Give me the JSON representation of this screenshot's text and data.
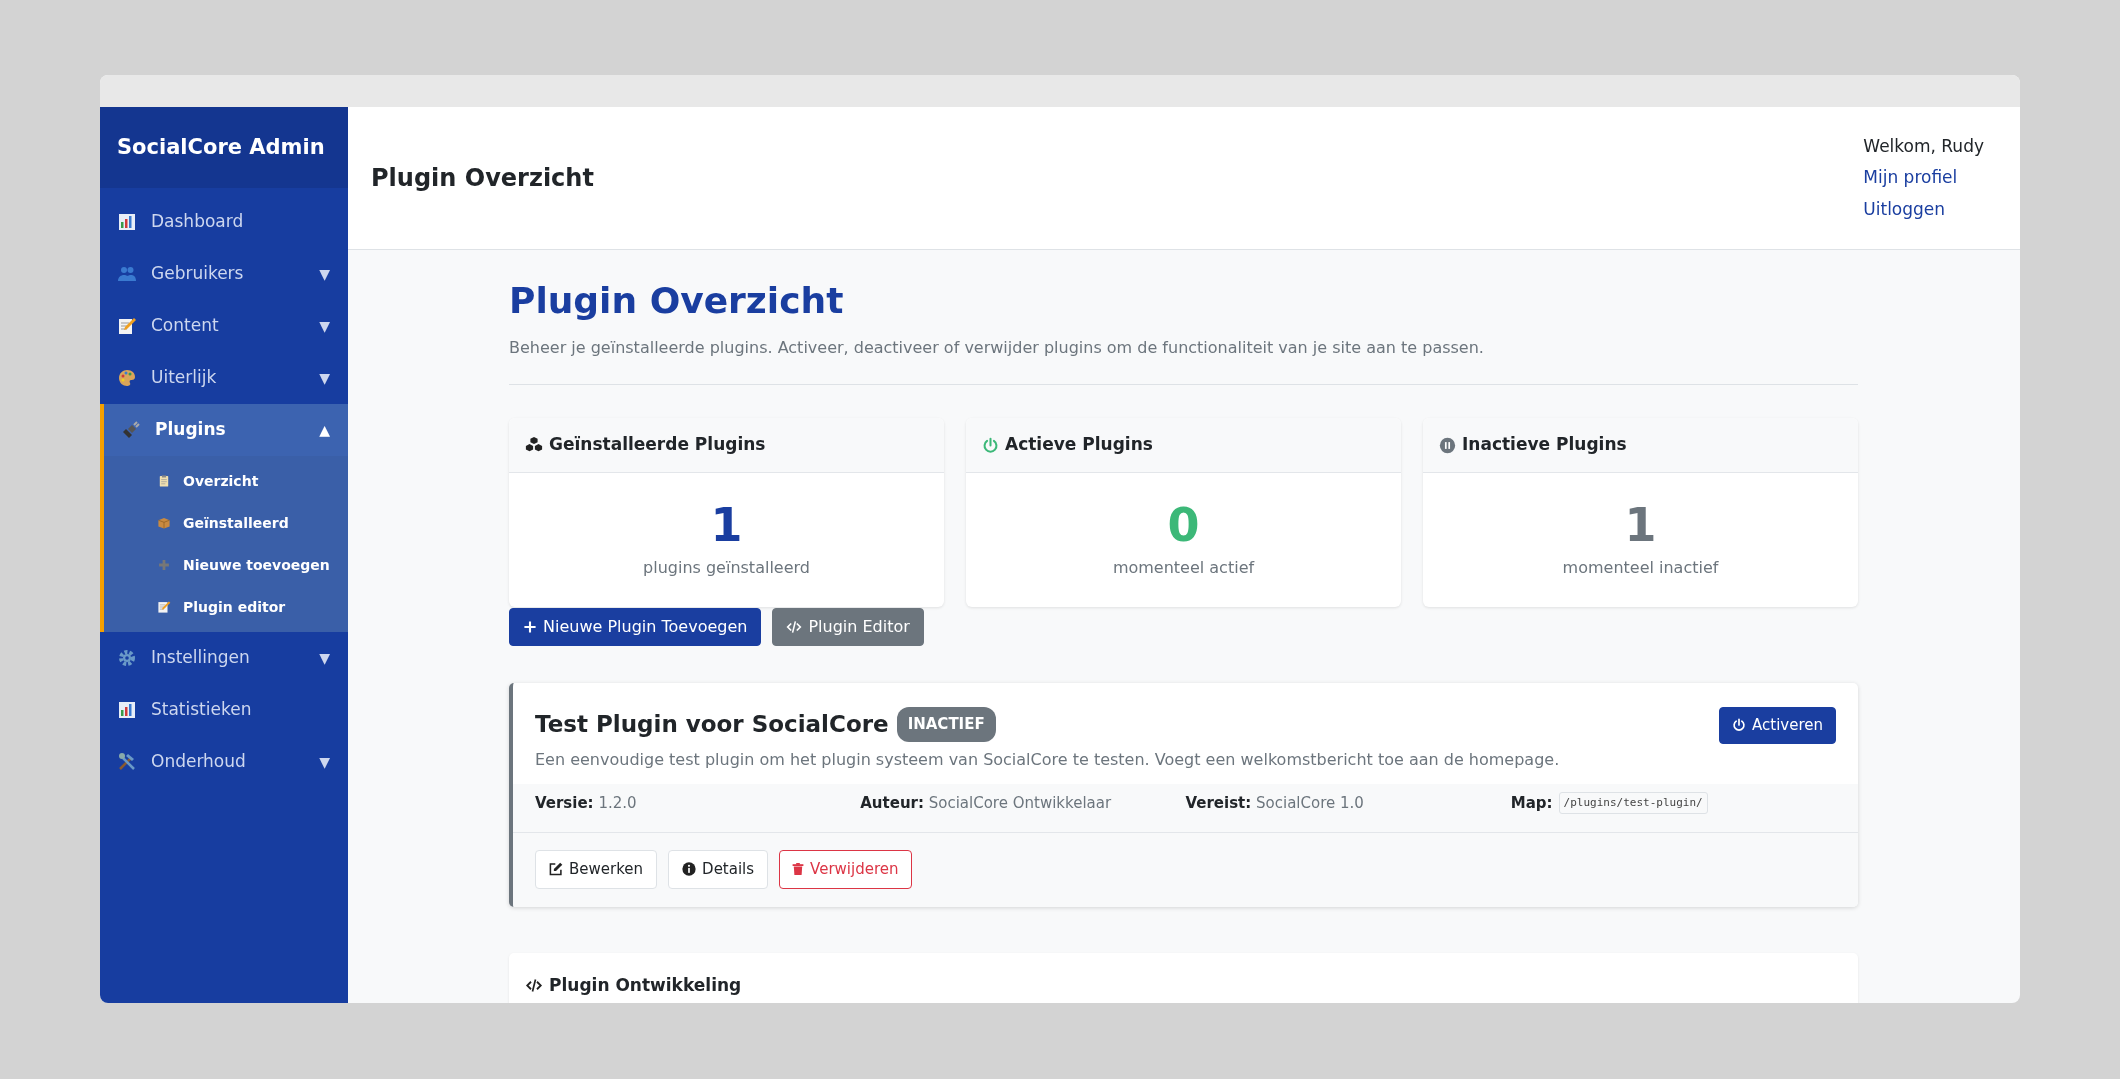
{
  "sidebar": {
    "brand": "SocialCore Admin",
    "items": [
      {
        "label": "Dashboard",
        "selected": false
      },
      {
        "label": "Gebruikers",
        "caret": "▼",
        "selected": false
      },
      {
        "label": "Content",
        "caret": "▼",
        "selected": false
      },
      {
        "label": "Uiterlijk",
        "caret": "▼",
        "selected": false
      },
      {
        "label": "Plugins",
        "caret": "▲",
        "selected": true,
        "expanded": true,
        "children": [
          {
            "label": "Overzicht",
            "selected": false
          },
          {
            "label": "Geïnstalleerd",
            "selected": false
          },
          {
            "label": "Nieuwe toevoegen",
            "selected": false
          },
          {
            "label": "Plugin editor",
            "selected": false
          }
        ]
      },
      {
        "label": "Instellingen",
        "caret": "▼",
        "selected": false
      },
      {
        "label": "Statistieken",
        "selected": false
      },
      {
        "label": "Onderhoud",
        "caret": "▼",
        "selected": false
      }
    ]
  },
  "topbar": {
    "title": "Plugin Overzicht",
    "user": {
      "greeting": "Welkom, Rudy",
      "links": [
        "Mijn profiel",
        "Uitloggen"
      ]
    }
  },
  "page": {
    "title": "Plugin Overzicht",
    "intro": "Beheer je geïnstalleerde plugins. Activeer, deactiveer of verwijder plugins om de functionaliteit van je site aan te passen."
  },
  "stats": [
    {
      "title": "Geïnstalleerde Plugins",
      "value": "1",
      "caption": "plugins geïnstalleerd",
      "color": "#1a3ea0"
    },
    {
      "title": "Actieve Plugins",
      "value": "0",
      "caption": "momenteel actief",
      "color": "#3cb878"
    },
    {
      "title": "Inactieve Plugins",
      "value": "1",
      "caption": "momenteel inactief",
      "color": "#6c757d"
    }
  ],
  "actions": [
    {
      "label": "Nieuwe Plugin Toevoegen",
      "kind": "add"
    },
    {
      "label": "Plugin Editor",
      "kind": "editor"
    }
  ],
  "plugins": [
    {
      "name": "Test Plugin voor SocialCore",
      "status": "INACTIEF",
      "active": false,
      "description": "Een eenvoudige test plugin om het plugin systeem van SocialCore te testen. Voegt een welkomstbericht toe aan de homepage.",
      "toggle": "Activeren",
      "meta": [
        {
          "label": "Versie:",
          "value": "1.2.0",
          "kind": "text"
        },
        {
          "label": "Auteur:",
          "value": "SocialCore Ontwikkelaar",
          "kind": "text"
        },
        {
          "label": "Vereist:",
          "value": "SocialCore 1.0",
          "kind": "text"
        },
        {
          "label": "Map:",
          "value": "/plugins/test-plugin/",
          "kind": "code"
        }
      ],
      "buttons": [
        {
          "label": "Bewerken",
          "kind": "edit"
        },
        {
          "label": "Details",
          "kind": "info"
        },
        {
          "label": "Verwijderen",
          "kind": "delete"
        }
      ]
    }
  ],
  "dev_card": {
    "title": "Plugin Ontwikkeling"
  }
}
